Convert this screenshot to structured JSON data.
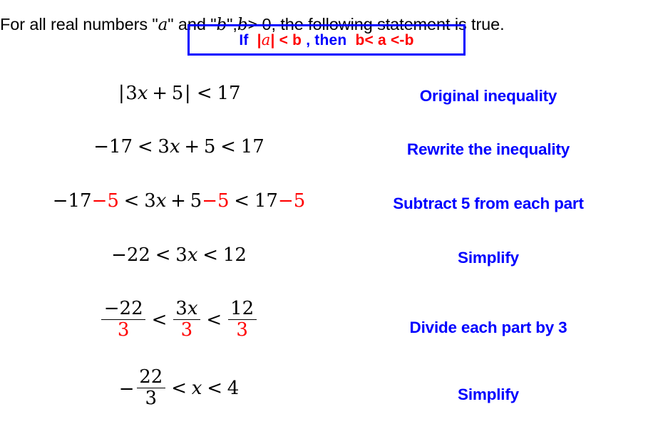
{
  "slide": {
    "background_color": "#ffffff",
    "text_color": "#000000",
    "accent_blue": "#0000ff",
    "accent_red": "#ff0000"
  },
  "title": {
    "part1": "For all real numbers \"",
    "var_a": "a",
    "part2": "\" and \"",
    "var_b": "b",
    "part3": "\", ",
    "var_b2": "b",
    "part4": " > 0, the following statement is true."
  },
  "rule_box": {
    "if_label": "If",
    "abs_open": "|",
    "abs_var": "a",
    "abs_close": "|",
    "lt1": "< b",
    "comma": ",",
    "then_label": "then",
    "conclusion": "b< a <-b",
    "border_color": "#0000ff"
  },
  "steps": [
    {
      "id": "step-1",
      "math": {
        "type": "inline",
        "plain": "|3x + 5| < 17",
        "abs_open": "|",
        "coef": "3",
        "var": "x",
        "plus": "+",
        "const": "5",
        "abs_close": "|",
        "rel": "<",
        "rhs": "17"
      },
      "label": "Original inequality"
    },
    {
      "id": "step-2",
      "math": {
        "type": "inline",
        "plain": "-17 < 3x + 5 < 17",
        "left": "−17",
        "rel1": "<",
        "coef": "3",
        "var": "x",
        "plus": "+",
        "const": "5",
        "rel2": "<",
        "right": "17"
      },
      "label": "Rewrite the inequality"
    },
    {
      "id": "step-3",
      "math": {
        "type": "inline",
        "plain": "-17-5 < 3x + 5-5 < 17-5",
        "left": "−17",
        "sub_left": "−5",
        "rel1": "<",
        "coef": "3",
        "var": "x",
        "plus": "+",
        "const": "5",
        "sub_mid": "−5",
        "rel2": "<",
        "right": "17",
        "sub_right": "−5"
      },
      "label": "Subtract 5 from each part",
      "label_number": "5"
    },
    {
      "id": "step-4",
      "math": {
        "type": "inline",
        "plain": "-22 < 3x < 12",
        "left": "−22",
        "rel1": "<",
        "coef": "3",
        "var": "x",
        "rel2": "<",
        "right": "12"
      },
      "label": "Simplify"
    },
    {
      "id": "step-5",
      "math": {
        "type": "fractions",
        "plain": "-22/3 < 3x/3 < 12/3",
        "f1_num": "−22",
        "f1_den": "3",
        "rel1": "<",
        "f2_num_coef": "3",
        "f2_num_var": "x",
        "f2_den": "3",
        "rel2": "<",
        "f3_num": "12",
        "f3_den": "3"
      },
      "label": "Divide each part by 3",
      "label_number": "3"
    },
    {
      "id": "step-6",
      "math": {
        "type": "fraction-final",
        "plain": "-22/3 < x < 4",
        "minus": "−",
        "f_num": "22",
        "f_den": "3",
        "rel1": "<",
        "var": "x",
        "rel2": "<",
        "right": "4"
      },
      "label": "Simplify"
    }
  ]
}
